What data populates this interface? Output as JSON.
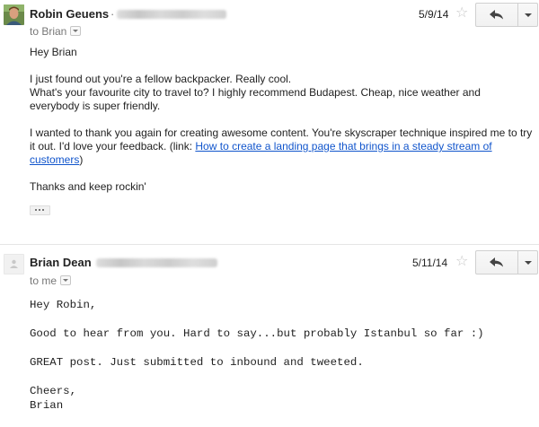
{
  "messages": [
    {
      "sender": "Robin Geuens",
      "sender_separator": "·",
      "recipient": "to Brian",
      "date": "5/9/14",
      "body": {
        "greeting": "Hey Brian",
        "p1_line1": "I just found out you're a fellow backpacker. Really cool.",
        "p1_line2": "What's your favourite city to travel to? I highly recommend Budapest. Cheap, nice weather and everybody is super friendly.",
        "p2_text": "I wanted to thank you again for creating awesome content. You're skyscraper technique inspired me to try it out. I'd love your feedback. (link: ",
        "p2_link": "How to create a landing page that brings in a steady stream of customers",
        "p2_close": ")",
        "closing": "Thanks and keep rockin'"
      },
      "icons": {
        "avatar": "avatar-photo",
        "star": "star-icon",
        "reply": "reply-icon",
        "more": "dropdown-arrow-icon",
        "trimmed": "show-trimmed-content-icon"
      }
    },
    {
      "sender": "Brian Dean",
      "recipient": "to me",
      "date": "5/11/14",
      "body": {
        "greeting": "Hey Robin,",
        "p1": "Good to hear from you. Hard to say...but probably Istanbul so far :)",
        "p2": "GREAT post. Just submitted to inbound and tweeted.",
        "sign1": "Cheers,",
        "sign2": "Brian"
      },
      "icons": {
        "avatar": "default-avatar-icon",
        "star": "star-icon",
        "reply": "reply-icon",
        "more": "dropdown-arrow-icon"
      }
    }
  ],
  "colors": {
    "link": "#1155cc",
    "text": "#222222",
    "muted": "#777777",
    "star": "#c6c6c6"
  }
}
